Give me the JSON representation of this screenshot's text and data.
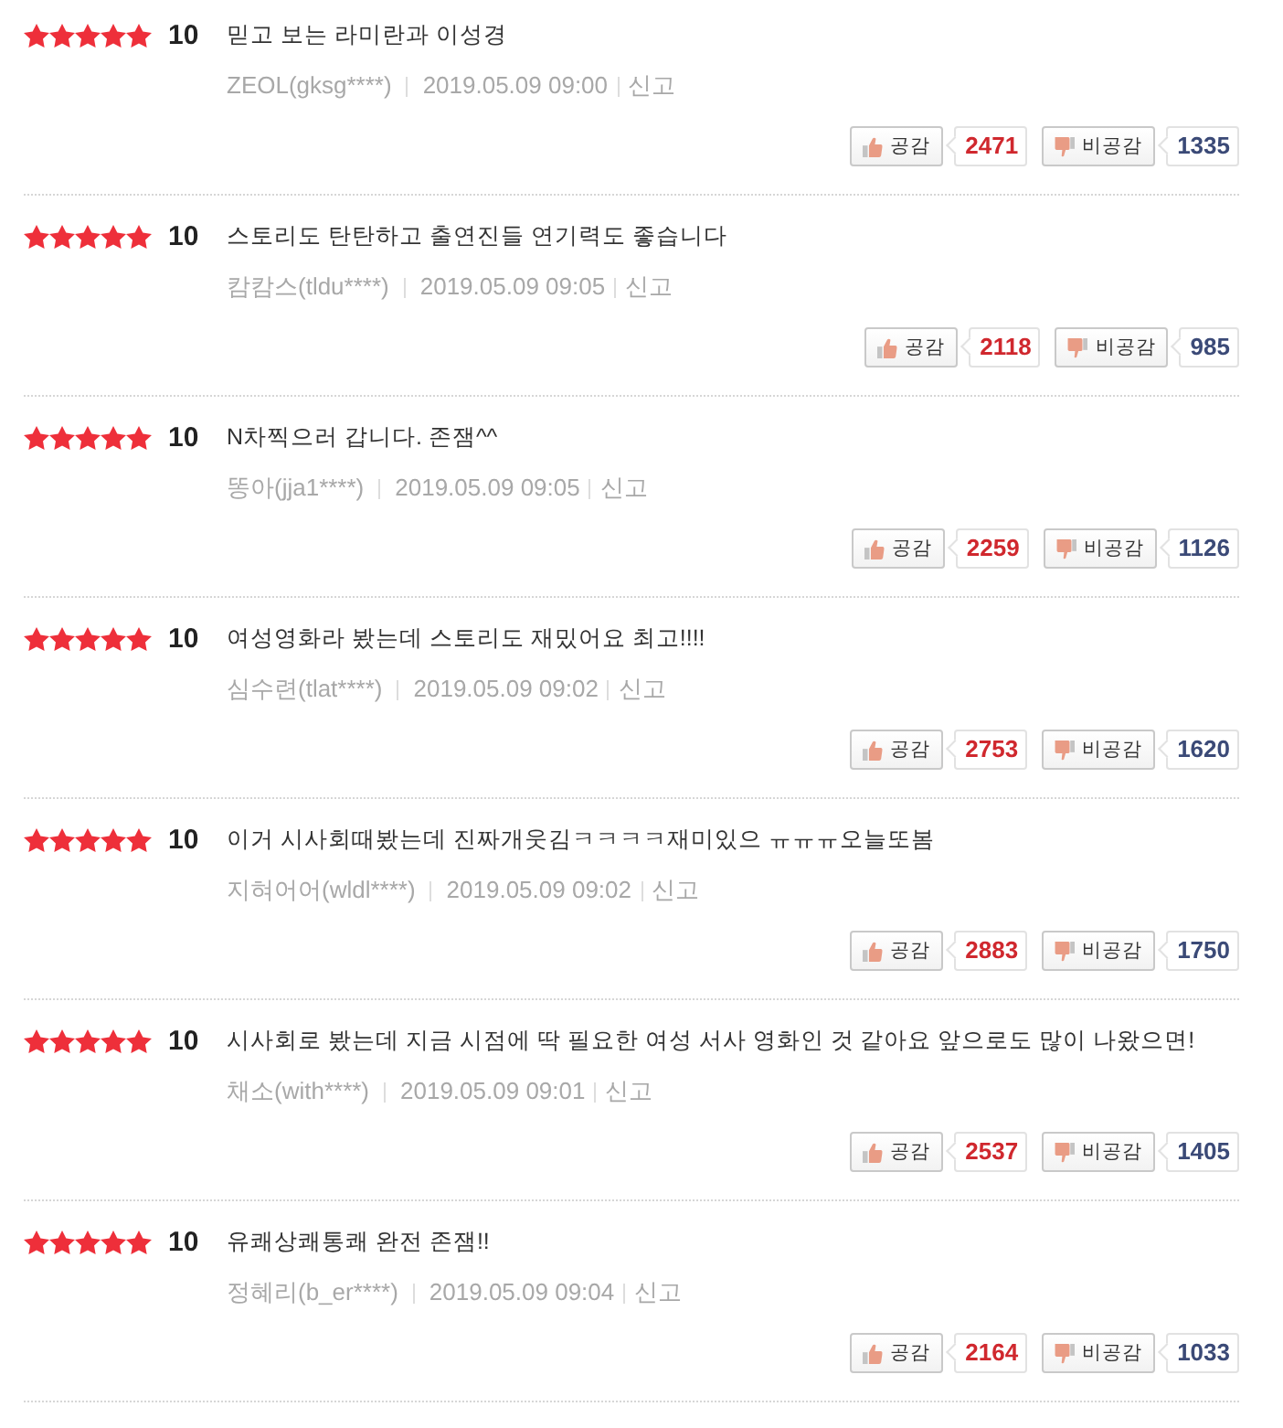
{
  "reviews": [
    {
      "stars": 5,
      "score": "10",
      "comment": "믿고 보는 라미란과 이성경",
      "author": "ZEOL(gksg****)",
      "date": "2019.05.09 09:00",
      "report": "신고",
      "like": {
        "label": "공감",
        "count": "2471"
      },
      "dislike": {
        "label": "비공감",
        "count": "1335"
      }
    },
    {
      "stars": 5,
      "score": "10",
      "comment": "스토리도 탄탄하고 출연진들 연기력도 좋습니다",
      "author": "캄캄스(tldu****)",
      "date": "2019.05.09 09:05",
      "report": "신고",
      "like": {
        "label": "공감",
        "count": "2118"
      },
      "dislike": {
        "label": "비공감",
        "count": "985"
      }
    },
    {
      "stars": 5,
      "score": "10",
      "comment": "N차찍으러 갑니다. 존잼^^",
      "author": "똥아(jja1****)",
      "date": "2019.05.09 09:05",
      "report": "신고",
      "like": {
        "label": "공감",
        "count": "2259"
      },
      "dislike": {
        "label": "비공감",
        "count": "1126"
      }
    },
    {
      "stars": 5,
      "score": "10",
      "comment": "여성영화라 봤는데 스토리도 재밌어요 최고!!!!",
      "author": "심수련(tlat****)",
      "date": "2019.05.09 09:02",
      "report": "신고",
      "like": {
        "label": "공감",
        "count": "2753"
      },
      "dislike": {
        "label": "비공감",
        "count": "1620"
      }
    },
    {
      "stars": 5,
      "score": "10",
      "comment": "이거 시사회때봤는데 진짜개웃김ㅋㅋㅋㅋ재미있으 ㅠㅠㅠ오늘또봄",
      "author": "지혀어어(wldl****)",
      "date": "2019.05.09 09:02",
      "report": "신고",
      "like": {
        "label": "공감",
        "count": "2883"
      },
      "dislike": {
        "label": "비공감",
        "count": "1750"
      }
    },
    {
      "stars": 5,
      "score": "10",
      "comment": "시사회로 봤는데 지금 시점에 딱 필요한 여성 서사 영화인 것 같아요 앞으로도 많이 나왔으면!",
      "author": "채소(with****)",
      "date": "2019.05.09 09:01",
      "report": "신고",
      "like": {
        "label": "공감",
        "count": "2537"
      },
      "dislike": {
        "label": "비공감",
        "count": "1405"
      }
    },
    {
      "stars": 5,
      "score": "10",
      "comment": "유쾌상쾌통쾌 완전 존잼!!",
      "author": "정혜리(b_er****)",
      "date": "2019.05.09 09:04",
      "report": "신고",
      "like": {
        "label": "공감",
        "count": "2164"
      },
      "dislike": {
        "label": "비공감",
        "count": "1033"
      }
    }
  ]
}
